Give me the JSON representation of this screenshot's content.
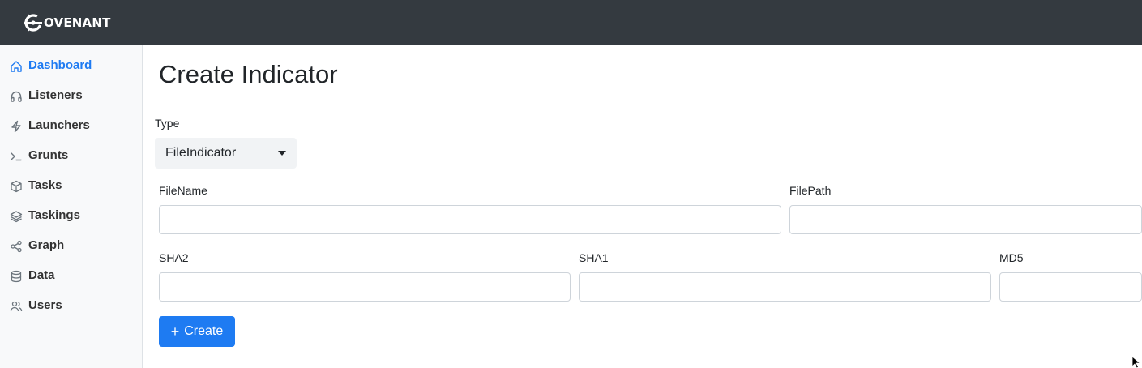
{
  "app": {
    "logo_text": "OVENANT",
    "logo_initial_mark": "C"
  },
  "colors": {
    "topbar": "#343a40",
    "accent": "#1e7bf2",
    "sidebar_bg": "#f8f9fa"
  },
  "sidebar": {
    "items": [
      {
        "label": "Dashboard",
        "icon": "home-icon",
        "active": true
      },
      {
        "label": "Listeners",
        "icon": "headphones-icon"
      },
      {
        "label": "Launchers",
        "icon": "lightning-icon"
      },
      {
        "label": "Grunts",
        "icon": "terminal-icon"
      },
      {
        "label": "Tasks",
        "icon": "box-icon"
      },
      {
        "label": "Taskings",
        "icon": "layers-icon"
      },
      {
        "label": "Graph",
        "icon": "share-icon"
      },
      {
        "label": "Data",
        "icon": "database-icon"
      },
      {
        "label": "Users",
        "icon": "users-icon"
      }
    ]
  },
  "page": {
    "title": "Create Indicator"
  },
  "form": {
    "type": {
      "label": "Type",
      "value": "FileIndicator"
    },
    "filename": {
      "label": "FileName",
      "value": ""
    },
    "filepath": {
      "label": "FilePath",
      "value": ""
    },
    "sha2": {
      "label": "SHA2",
      "value": ""
    },
    "sha1": {
      "label": "SHA1",
      "value": ""
    },
    "md5": {
      "label": "MD5",
      "value": ""
    },
    "create_button": {
      "label": "Create",
      "icon": "plus-icon"
    }
  }
}
